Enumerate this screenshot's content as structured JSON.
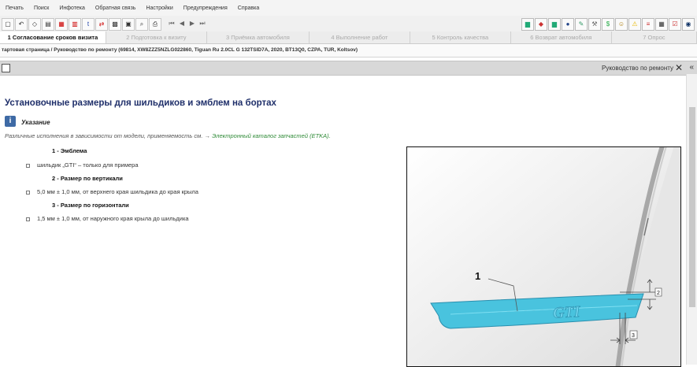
{
  "menu": [
    "Печать",
    "Поиск",
    "Инфотека",
    "Обратная связь",
    "Настройки",
    "Предупреждения",
    "Справка"
  ],
  "toolbar": {
    "left_icons": [
      "new-doc-icon",
      "back-icon",
      "tag-icon",
      "document-icon",
      "report-icon",
      "book-icon",
      "text-icon",
      "transfer-icon",
      "engine-icon",
      "car-icon",
      "search-icon",
      "print-icon"
    ],
    "nav_icons": [
      "first-icon",
      "prev-icon",
      "next-icon",
      "last-icon"
    ],
    "right_icons": [
      "car-icon",
      "service-icon",
      "vehicle-icon",
      "globe-icon",
      "tools-icon",
      "wrench-icon",
      "dollar-icon",
      "people-icon",
      "warning-icon",
      "list-icon",
      "grid-icon",
      "check-icon",
      "sphere-icon"
    ]
  },
  "tabs": [
    {
      "label": "1 Согласование сроков визита",
      "active": true
    },
    {
      "label": "2 Подготовка к визиту",
      "active": false
    },
    {
      "label": "3 Приёмка автомобиля",
      "active": false
    },
    {
      "label": "4 Выполнение работ",
      "active": false
    },
    {
      "label": "5 Контроль качества",
      "active": false
    },
    {
      "label": "6 Возврат автомобиля",
      "active": false
    },
    {
      "label": "7 Опрос",
      "active": false
    }
  ],
  "breadcrumb": "тартовая страница / Руководство по ремонту (69814, XW8ZZZ5NZLG022860, Tiguan Ru 2.0CL G 132TSID7A, 2020, BT13Q0, CZPA, TUR, Koltsov)",
  "panel": {
    "title": "Руководство по ремонту",
    "close": "✕",
    "back": "«"
  },
  "doc": {
    "title": "Установочные размеры для шильдиков и эмблем на бортах",
    "note_label": "Указание",
    "note_text": "Различные исполнения в зависимости от модели, применяемость см. → ",
    "note_link": "Электронный каталог запчастей (ETKA).",
    "items": [
      {
        "label": "1 - Эмблема",
        "bullet": "шильдик „GTI“ – только для примера"
      },
      {
        "label": "2 - Размер по вертикали",
        "bullet": "5,0 мм ± 1,0 мм, от верхнего края шильдика до края крыла"
      },
      {
        "label": "3 - Размер по горизонтали",
        "bullet": "1,5 мм ± 1,0 мм, от наружного края крыла до шильдика"
      }
    ]
  },
  "figure": {
    "callout": "1",
    "dim_vertical": "2",
    "dim_horizontal": "3",
    "emblem": "GTI"
  }
}
